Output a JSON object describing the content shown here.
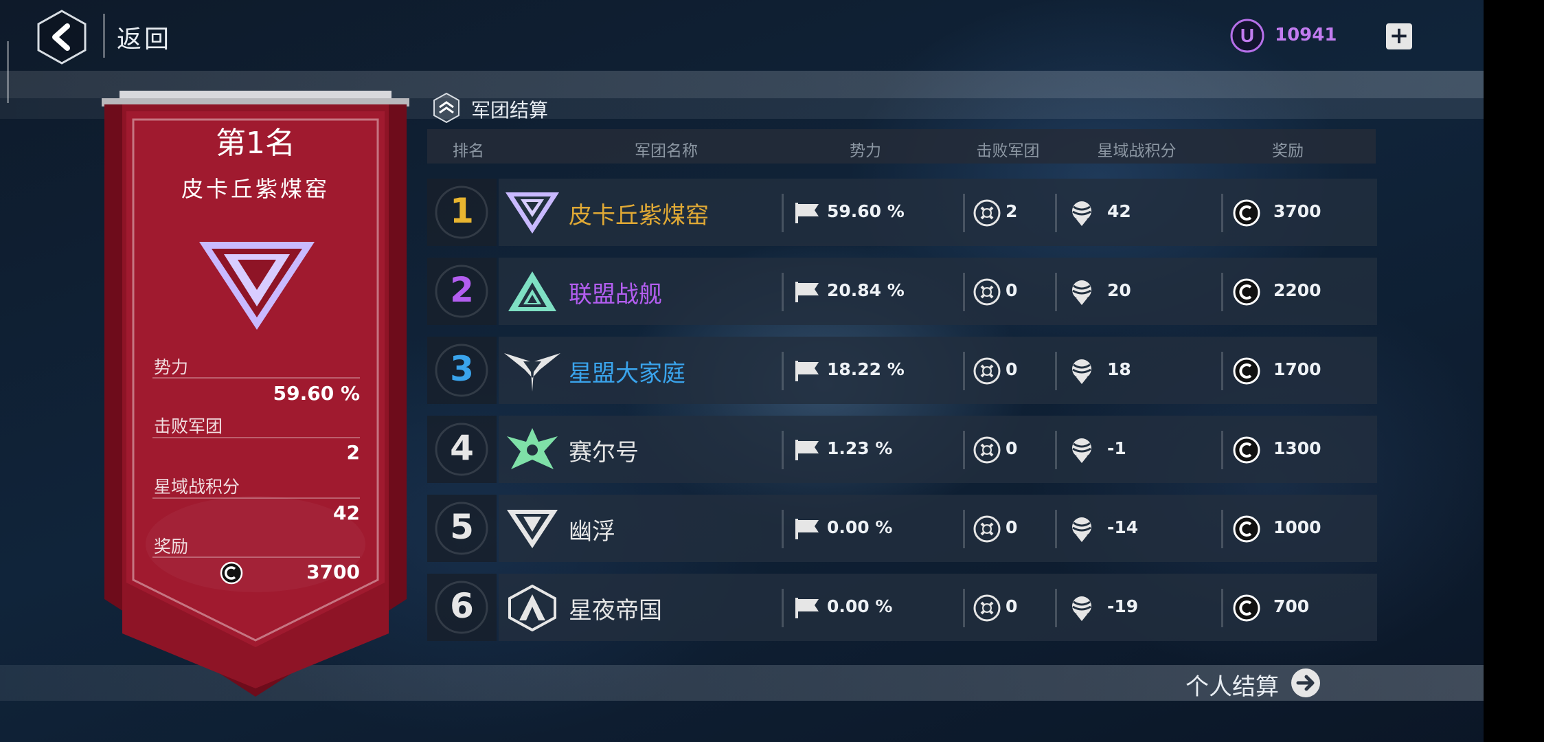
{
  "header": {
    "back_label": "返回",
    "currency_value": "10941",
    "currency_icon": "u-coin-icon",
    "plus_icon": "plus-icon"
  },
  "section": {
    "title": "军团结算"
  },
  "banner": {
    "rank_title": "第1名",
    "guild_name": "皮卡丘紫煤窑",
    "stats": [
      {
        "label": "势力",
        "value": "59.60 %"
      },
      {
        "label": "击败军团",
        "value": "2"
      },
      {
        "label": "星域战积分",
        "value": "42"
      },
      {
        "label": "奖励",
        "value": "3700"
      }
    ],
    "color": "#8e1426"
  },
  "table": {
    "headers": [
      "排名",
      "军团名称",
      "势力",
      "击败军团",
      "星域战积分",
      "奖励"
    ],
    "rows": [
      {
        "rank": "1",
        "name": "皮卡丘紫煤窑",
        "power": "59.60 %",
        "defeated": "2",
        "score": "42",
        "reward": "3700",
        "rank_color": "#e8b530",
        "name_color": "#e0a935"
      },
      {
        "rank": "2",
        "name": "联盟战舰",
        "power": "20.84 %",
        "defeated": "0",
        "score": "20",
        "reward": "2200",
        "rank_color": "#b35ef0",
        "name_color": "#b35ef0"
      },
      {
        "rank": "3",
        "name": "星盟大家庭",
        "power": "18.22 %",
        "defeated": "0",
        "score": "18",
        "reward": "1700",
        "rank_color": "#3aa4ec",
        "name_color": "#3aa4ec"
      },
      {
        "rank": "4",
        "name": "赛尔号",
        "power": "1.23 %",
        "defeated": "0",
        "score": "-1",
        "reward": "1300",
        "rank_color": "#e6e6e6",
        "name_color": "#e6e6e6"
      },
      {
        "rank": "5",
        "name": "幽浮",
        "power": "0.00 %",
        "defeated": "0",
        "score": "-14",
        "reward": "1000",
        "rank_color": "#e6e6e6",
        "name_color": "#e6e6e6"
      },
      {
        "rank": "6",
        "name": "星夜帝国",
        "power": "0.00 %",
        "defeated": "0",
        "score": "-19",
        "reward": "700",
        "rank_color": "#e6e6e6",
        "name_color": "#e6e6e6"
      }
    ]
  },
  "footer": {
    "personal_label": "个人结算"
  },
  "colors": {
    "accent_purple": "#c27cf0",
    "banner_red": "#8e1426"
  }
}
